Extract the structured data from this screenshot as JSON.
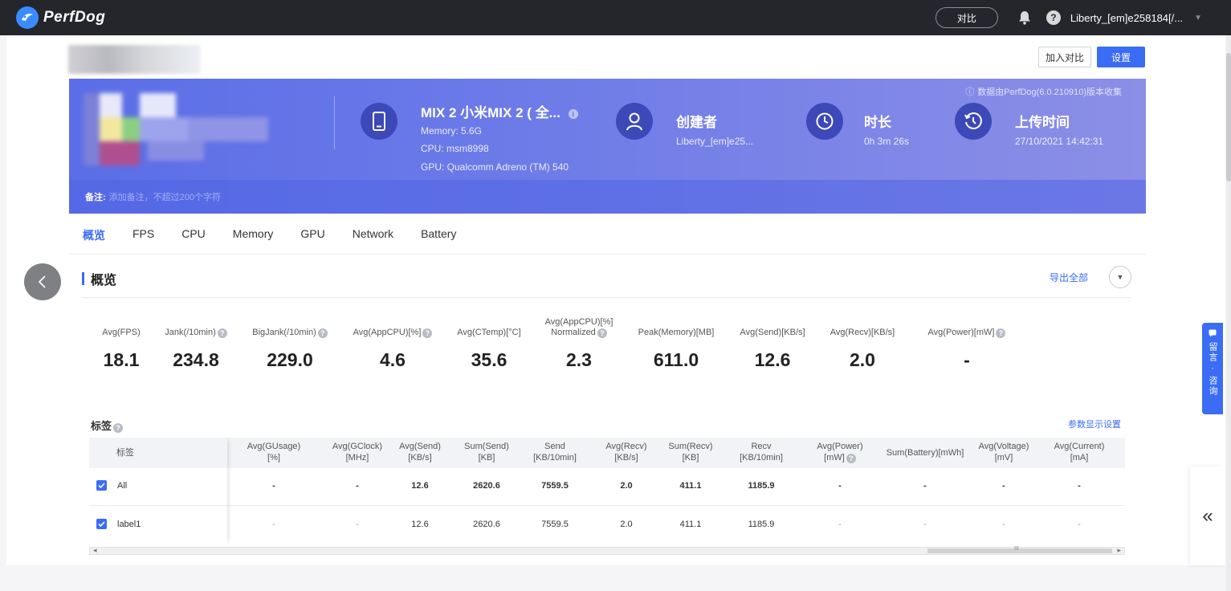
{
  "app": {
    "name": "PerfDog"
  },
  "topbar": {
    "compare_label": "对比",
    "help_label": "?",
    "user": "Liberty_[em]e258184[/..."
  },
  "actions": {
    "add_compare": "加入对比",
    "settings": "设置"
  },
  "banner": {
    "collect_note": "数据由PerfDog(6.0.210910)版本收集",
    "device": {
      "title": "MIX 2 小米MIX 2 ( 全...",
      "memory": "Memory: 5.6G",
      "cpu": "CPU: msm8998",
      "gpu": "GPU: Qualcomm Adreno (TM) 540"
    },
    "creator": {
      "title": "创建者",
      "value": "Liberty_[em]e25..."
    },
    "duration": {
      "title": "时长",
      "value": "0h 3m 26s"
    },
    "upload": {
      "title": "上传时间",
      "value": "27/10/2021 14:42:31"
    },
    "note_label": "备注:",
    "note_placeholder": "添加备注，不超过200个字符"
  },
  "tabs": [
    "概览",
    "FPS",
    "CPU",
    "Memory",
    "GPU",
    "Network",
    "Battery"
  ],
  "overview": {
    "title": "概览",
    "export_all": "导出全部",
    "metrics": [
      {
        "label": "Avg(FPS)",
        "value": "18.1"
      },
      {
        "label": "Jank(/10min)",
        "value": "234.8"
      },
      {
        "label": "BigJank(/10min)",
        "value": "229.0"
      },
      {
        "label": "Avg(AppCPU)[%]",
        "value": "4.6"
      },
      {
        "label": "Avg(CTemp)[°C]",
        "value": "35.6"
      },
      {
        "label": "Avg(AppCPU)[%]",
        "label2": "Normalized",
        "value": "2.3"
      },
      {
        "label": "Peak(Memory)[MB]",
        "value": "611.0"
      },
      {
        "label": "Avg(Send)[KB/s]",
        "value": "12.6"
      },
      {
        "label": "Avg(Recv)[KB/s]",
        "value": "2.0"
      },
      {
        "label": "Avg(Power)[mW]",
        "value": "-"
      }
    ],
    "tags_title": "标签",
    "param_settings": "参数显示设置"
  },
  "table": {
    "label_header": "标签",
    "columns": [
      [
        "Avg(GUsage)",
        "[%]"
      ],
      [
        "Avg(GClock)",
        "[MHz]"
      ],
      [
        "Avg(Send)",
        "[KB/s]"
      ],
      [
        "Sum(Send)",
        "[KB]"
      ],
      [
        "Send",
        "[KB/10min]"
      ],
      [
        "Avg(Recv)",
        "[KB/s]"
      ],
      [
        "Sum(Recv)",
        "[KB]"
      ],
      [
        "Recv",
        "[KB/10min]"
      ],
      [
        "Avg(Power)",
        "[mW]"
      ],
      [
        "Sum(Battery)[mWh]",
        ""
      ],
      [
        "Avg(Voltage)",
        "[mV]"
      ],
      [
        "Avg(Current)",
        "[mA]"
      ]
    ],
    "rows": [
      {
        "label": "All",
        "cells": [
          "-",
          "-",
          "12.6",
          "2620.6",
          "7559.5",
          "2.0",
          "411.1",
          "1185.9",
          "-",
          "-",
          "-",
          "-"
        ]
      },
      {
        "label": "label1",
        "cells": [
          "-",
          "-",
          "12.6",
          "2620.6",
          "7559.5",
          "2.0",
          "411.1",
          "1185.9",
          "-",
          "-",
          "-",
          "-"
        ]
      }
    ],
    "scroll_mark": "III"
  },
  "side": {
    "feedback": "留言 · 咨询",
    "collapse_glyph": "«"
  },
  "colors": {
    "accent": "#3b6cf6",
    "topbar": "#24262c",
    "banner_start": "#5b6ee7",
    "banner_end": "#8c8fe6"
  },
  "icons": [
    "perfdog-logo-icon",
    "bell-icon",
    "help-icon",
    "caret-down-icon",
    "phone-icon",
    "user-icon",
    "clock-icon",
    "history-icon",
    "info-icon",
    "chevron-down-icon",
    "chevron-left-icon",
    "checkbox-icon",
    "chat-icon",
    "double-chevron-left-icon"
  ]
}
